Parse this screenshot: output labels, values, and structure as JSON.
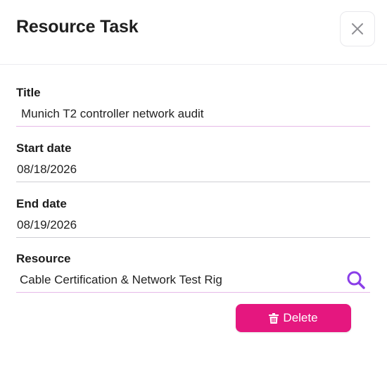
{
  "dialog": {
    "title": "Resource Task",
    "close_icon": "close-icon"
  },
  "fields": {
    "title": {
      "label": "Title",
      "value": "Munich T2 controller network audit"
    },
    "start_date": {
      "label": "Start date",
      "value": "08/18/2026"
    },
    "end_date": {
      "label": "End date",
      "value": "08/19/2026"
    },
    "resource": {
      "label": "Resource",
      "value": "Cable Certification & Network Test Rig",
      "search_icon": "search-icon"
    }
  },
  "actions": {
    "delete_label": "Delete",
    "delete_icon": "trash-icon"
  },
  "colors": {
    "accent": "#e5177f",
    "search_icon": "#8a3ee8",
    "title_underline": "#e6b9e8"
  }
}
